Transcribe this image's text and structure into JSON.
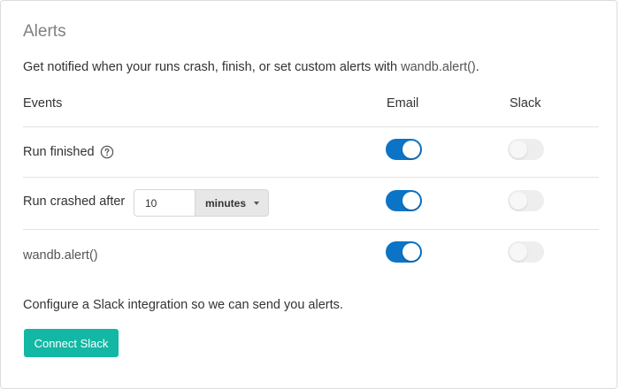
{
  "alerts": {
    "title": "Alerts",
    "description_prefix": "Get notified when your runs crash, finish, or set custom alerts with ",
    "description_code": "wandb.alert()",
    "description_suffix": ".",
    "columns": {
      "events": "Events",
      "email": "Email",
      "slack": "Slack"
    },
    "rows": [
      {
        "label": "Run finished",
        "has_help_icon": true,
        "icon": "help-circle-icon",
        "email_enabled": true,
        "slack_enabled": false
      },
      {
        "label": "Run crashed after",
        "threshold_value": "10",
        "threshold_unit": "minutes",
        "email_enabled": true,
        "slack_enabled": false
      },
      {
        "label": "wandb.alert()",
        "email_enabled": true,
        "slack_enabled": false
      }
    ],
    "slack_prompt": "Configure a Slack integration so we can send you alerts.",
    "connect_button_label": "Connect Slack"
  },
  "colors": {
    "toggle_on": "#0b74c7",
    "toggle_off": "#eeeeee",
    "connect_button": "#13b8a4",
    "title_text": "#808080"
  }
}
